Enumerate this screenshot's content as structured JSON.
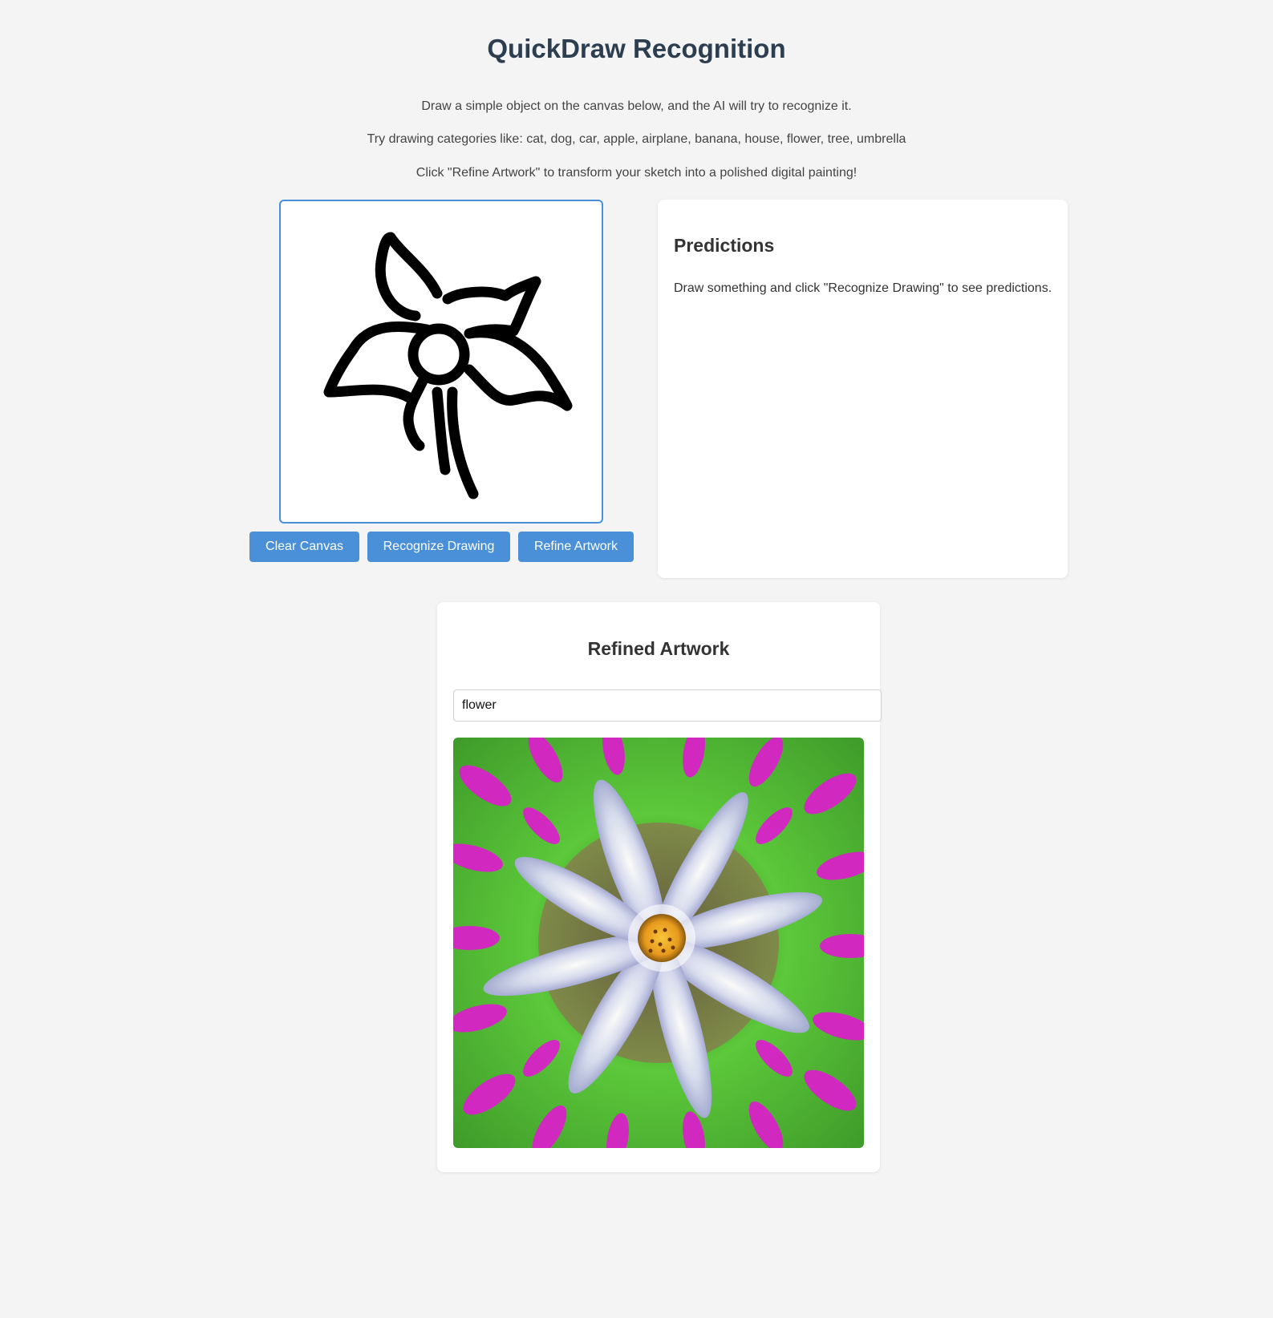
{
  "header": {
    "title": "QuickDraw Recognition",
    "instructions": [
      "Draw a simple object on the canvas below, and the AI will try to recognize it.",
      "Try drawing categories like: cat, dog, car, apple, airplane, banana, house, flower, tree, umbrella",
      "Click \"Refine Artwork\" to transform your sketch into a polished digital painting!"
    ]
  },
  "controls": {
    "clear_label": "Clear Canvas",
    "recognize_label": "Recognize Drawing",
    "refine_label": "Refine Artwork"
  },
  "predictions": {
    "title": "Predictions",
    "placeholder_text": "Draw something and click \"Recognize Drawing\" to see predictions."
  },
  "refined": {
    "title": "Refined Artwork",
    "prompt_value": "flower"
  },
  "colors": {
    "accent": "#4a90d9",
    "title": "#2c3e50",
    "background": "#f4f4f4"
  }
}
